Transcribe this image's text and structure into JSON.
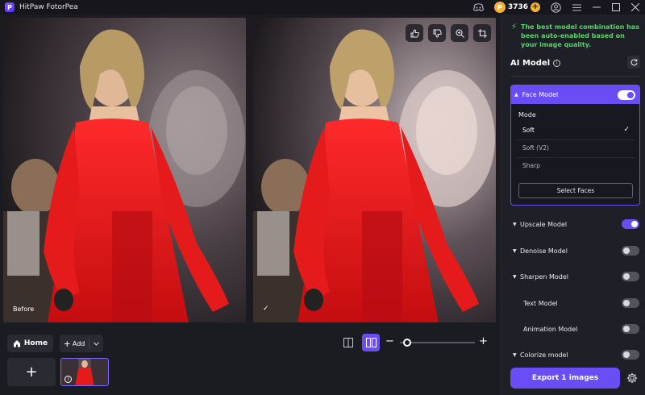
{
  "app": {
    "title": "HitPaw FotorPea",
    "logo_letter": "P"
  },
  "titlebar": {
    "credits": "3736",
    "icons": [
      "discord-icon",
      "coin-icon",
      "plus-coin-icon",
      "user-icon",
      "menu-icon"
    ],
    "window_controls": [
      "minimize",
      "maximize",
      "close"
    ]
  },
  "canvas": {
    "before_label": "Before",
    "tools": [
      "thumbs-up-icon",
      "thumbs-down-icon",
      "zoom-in-icon",
      "crop-icon"
    ]
  },
  "bottom": {
    "home_label": "Home",
    "add_label": "Add",
    "zoom_percent": 5
  },
  "sidebar": {
    "tip": "The best model combination has been auto-enabled based on your image quality.",
    "ai_model_title": "AI Model",
    "face_model": {
      "label": "Face Model",
      "enabled": true,
      "mode_label": "Mode",
      "options": [
        "Soft",
        "Soft (V2)",
        "Sharp"
      ],
      "selected": "Soft",
      "select_faces_label": "Select Faces"
    },
    "models": [
      {
        "label": "Upscale Model",
        "enabled": true,
        "expandable": true
      },
      {
        "label": "Denoise Model",
        "enabled": false,
        "expandable": true
      },
      {
        "label": "Sharpen Model",
        "enabled": false,
        "expandable": true
      },
      {
        "label": "Text Model",
        "enabled": false,
        "expandable": false
      },
      {
        "label": "Animation Model",
        "enabled": false,
        "expandable": false
      },
      {
        "label": "Colorize model",
        "enabled": false,
        "expandable": true
      }
    ],
    "export_label": "Export 1 images"
  },
  "colors": {
    "accent": "#6a4df5",
    "tip_green": "#5bd36b",
    "background": "#1b1b22"
  }
}
